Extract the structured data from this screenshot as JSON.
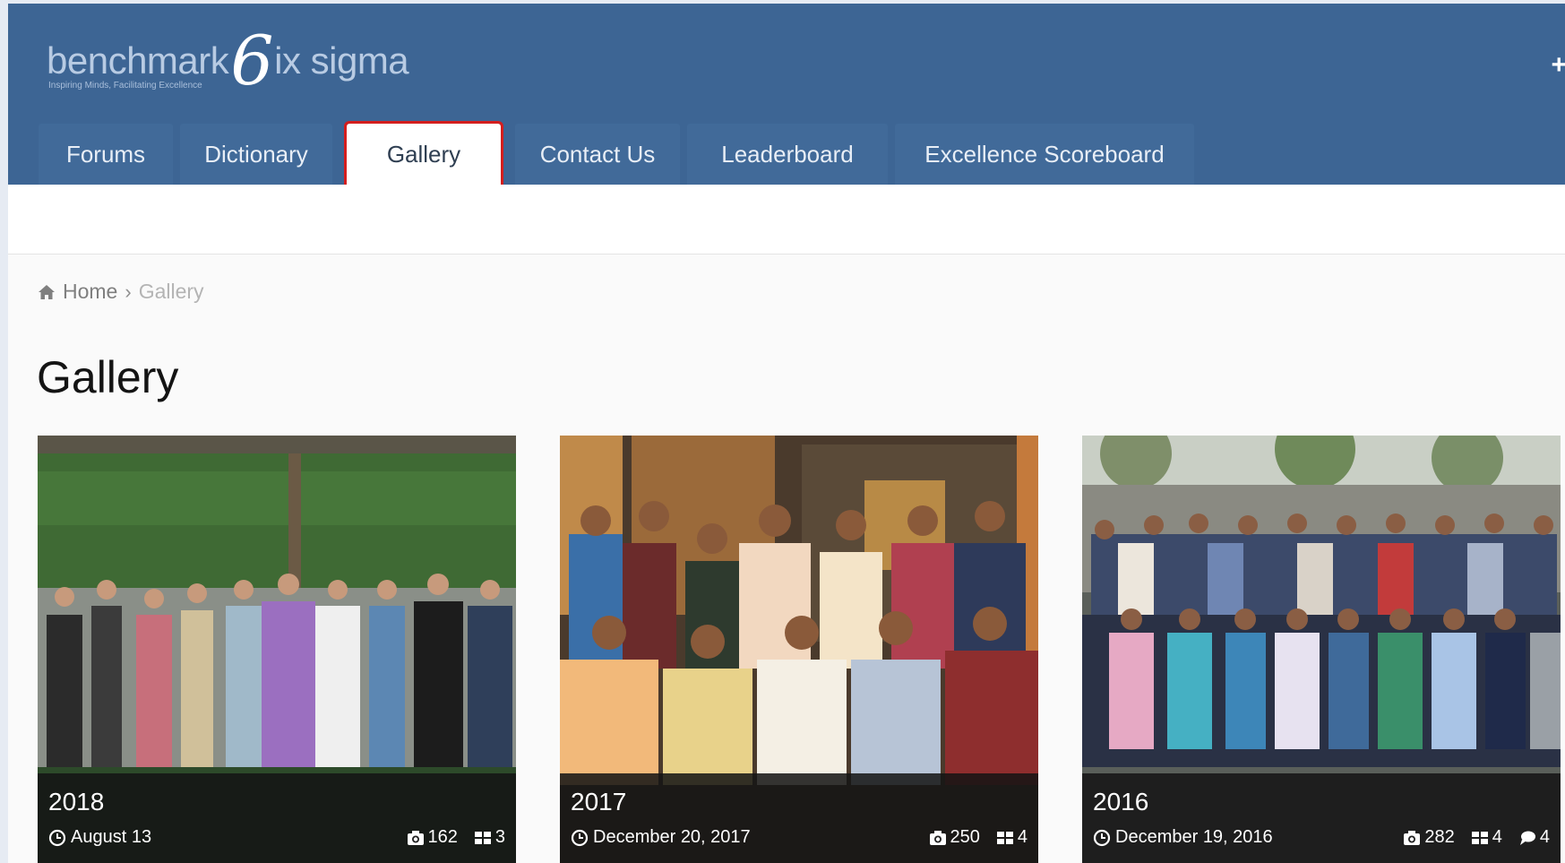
{
  "logo": {
    "name_before": "benchmark",
    "name_mark": "6",
    "name_after": "ix sigma",
    "tagline": "Inspiring Minds, Facilitating Excellence"
  },
  "nav": {
    "tabs": [
      {
        "label": "Forums"
      },
      {
        "label": "Dictionary"
      },
      {
        "label": "Gallery",
        "active": true
      },
      {
        "label": "Contact Us"
      },
      {
        "label": "Leaderboard"
      },
      {
        "label": "Excellence Scoreboard"
      }
    ]
  },
  "header_icon": "plus-icon",
  "breadcrumb": {
    "home": "Home",
    "current": "Gallery"
  },
  "page": {
    "title": "Gallery"
  },
  "albums": [
    {
      "title": "2018",
      "date": "August 13",
      "photos": "162",
      "albums": "3"
    },
    {
      "title": "2017",
      "date": "December 20, 2017",
      "photos": "250",
      "albums": "4"
    },
    {
      "title": "2016",
      "date": "December 19, 2016",
      "photos": "282",
      "albums": "4",
      "comments": "4"
    }
  ],
  "colors": {
    "header": "#3d6594",
    "tab": "#416a99",
    "active_highlight": "#d41e1e"
  }
}
